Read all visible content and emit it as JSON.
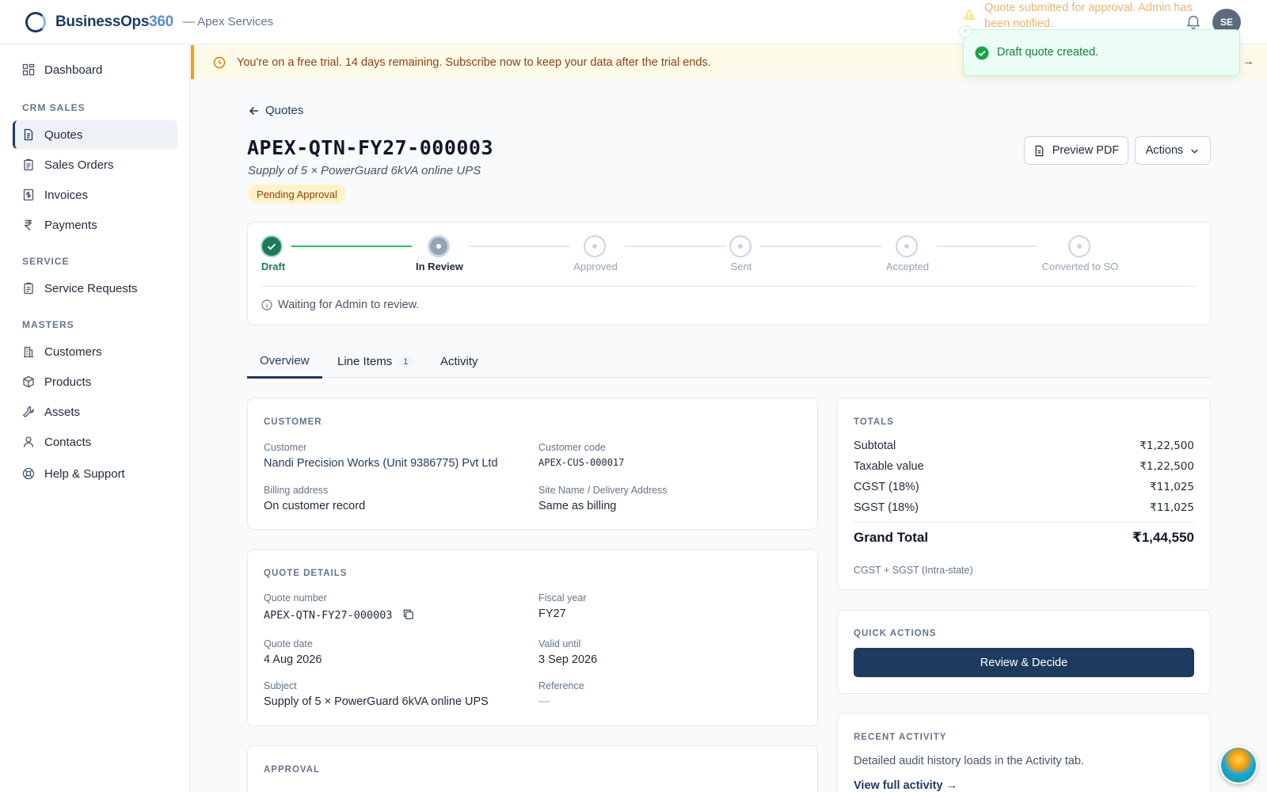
{
  "brand": {
    "name_main": "BusinessOps",
    "name_accent": "360",
    "org": "— Apex Services"
  },
  "user": {
    "initials": "SE"
  },
  "toasts": {
    "warning": "Quote submitted for approval. Admin has been notified.",
    "success": "Draft quote created.",
    "close": "×"
  },
  "banner": {
    "text": "You're on a free trial. 14 days remaining. Subscribe now to keep your data after the trial ends.",
    "arrow": "→"
  },
  "sidebar": {
    "dashboard": "Dashboard",
    "group_crm": "CRM SALES",
    "quotes": "Quotes",
    "sales_orders": "Sales Orders",
    "invoices": "Invoices",
    "payments": "Payments",
    "group_service": "SERVICE",
    "service_requests": "Service Requests",
    "group_masters": "MASTERS",
    "customers": "Customers",
    "products": "Products",
    "assets": "Assets",
    "contacts": "Contacts",
    "help": "Help & Support"
  },
  "page": {
    "back": "Quotes",
    "title": "APEX-QTN-FY27-000003",
    "subtitle": "Supply of 5 × PowerGuard 6kVA online UPS",
    "status": "Pending Approval",
    "preview_pdf": "Preview PDF",
    "actions": "Actions"
  },
  "stepper": {
    "steps": [
      "Draft",
      "In Review",
      "Approved",
      "Sent",
      "Accepted",
      "Converted to SO"
    ],
    "note": "Waiting for Admin to review."
  },
  "tabs": {
    "overview": "Overview",
    "line_items": "Line Items",
    "line_items_count": "1",
    "activity": "Activity"
  },
  "customer": {
    "heading": "CUSTOMER",
    "customer_label": "Customer",
    "customer_value": "Nandi Precision Works (Unit 9386775) Pvt Ltd",
    "code_label": "Customer code",
    "code_value": "APEX-CUS-000017",
    "billing_label": "Billing address",
    "billing_value": "On customer record",
    "site_label": "Site Name / Delivery Address",
    "site_value": "Same as billing"
  },
  "quote_details": {
    "heading": "QUOTE DETAILS",
    "number_label": "Quote number",
    "number_value": "APEX-QTN-FY27-000003",
    "fy_label": "Fiscal year",
    "fy_value": "FY27",
    "date_label": "Quote date",
    "date_value": "4 Aug 2026",
    "valid_label": "Valid until",
    "valid_value": "3 Sep 2026",
    "subject_label": "Subject",
    "subject_value": "Supply of 5 × PowerGuard 6kVA online UPS",
    "ref_label": "Reference",
    "ref_value": "—"
  },
  "approval": {
    "heading": "APPROVAL"
  },
  "totals": {
    "heading": "TOTALS",
    "subtotal_label": "Subtotal",
    "subtotal_value": "₹1,22,500",
    "taxable_label": "Taxable value",
    "taxable_value": "₹1,22,500",
    "cgst_label": "CGST (18%)",
    "cgst_value": "₹11,025",
    "sgst_label": "SGST (18%)",
    "sgst_value": "₹11,025",
    "grand_label": "Grand Total",
    "grand_value": "₹1,44,550",
    "note": "CGST + SGST (Intra-state)"
  },
  "quick_actions": {
    "heading": "QUICK ACTIONS",
    "review": "Review & Decide"
  },
  "recent_activity": {
    "heading": "RECENT ACTIVITY",
    "text": "Detailed audit history loads in the Activity tab.",
    "link": "View full activity →"
  }
}
